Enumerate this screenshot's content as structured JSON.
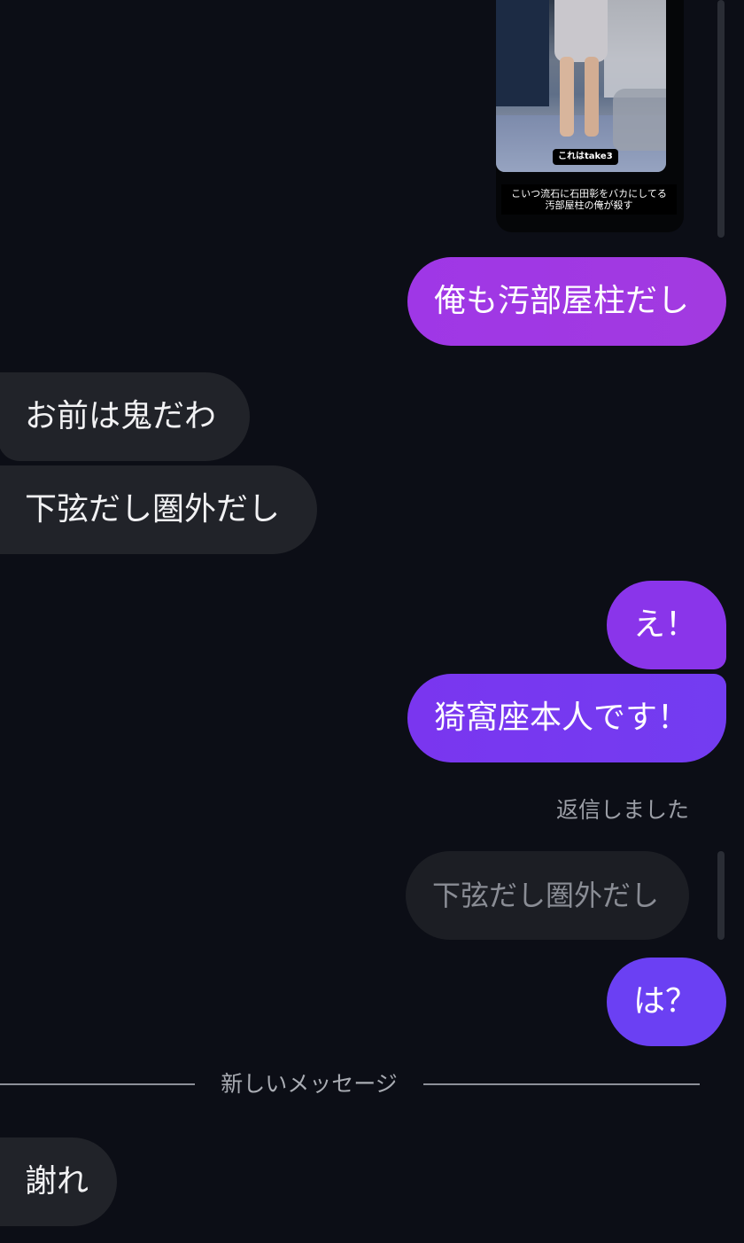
{
  "video": {
    "tag": "これはtake3",
    "caption_line1": "こいつ流石に石田彰をバカにしてる",
    "caption_line2": "汚部屋柱の俺が殺す"
  },
  "messages": [
    {
      "side": "out",
      "text": "俺も汚部屋柱だし"
    },
    {
      "side": "in",
      "text": "お前は鬼だわ"
    },
    {
      "side": "in",
      "text": "下弦だし圏外だし"
    },
    {
      "side": "out",
      "text": "え！"
    },
    {
      "side": "out",
      "text": "猗窩座本人です！"
    }
  ],
  "reply": {
    "status": "返信しました",
    "quoted": "下弦だし圏外だし",
    "text": "は？"
  },
  "divider": {
    "label": "新しいメッセージ"
  },
  "new_message": {
    "text": "謝れ"
  },
  "colors": {
    "background": "#0c0e16",
    "incoming_bubble": "#212329",
    "outgoing_gradient_start": "#a435e3",
    "outgoing_gradient_end": "#6b3ef2"
  }
}
